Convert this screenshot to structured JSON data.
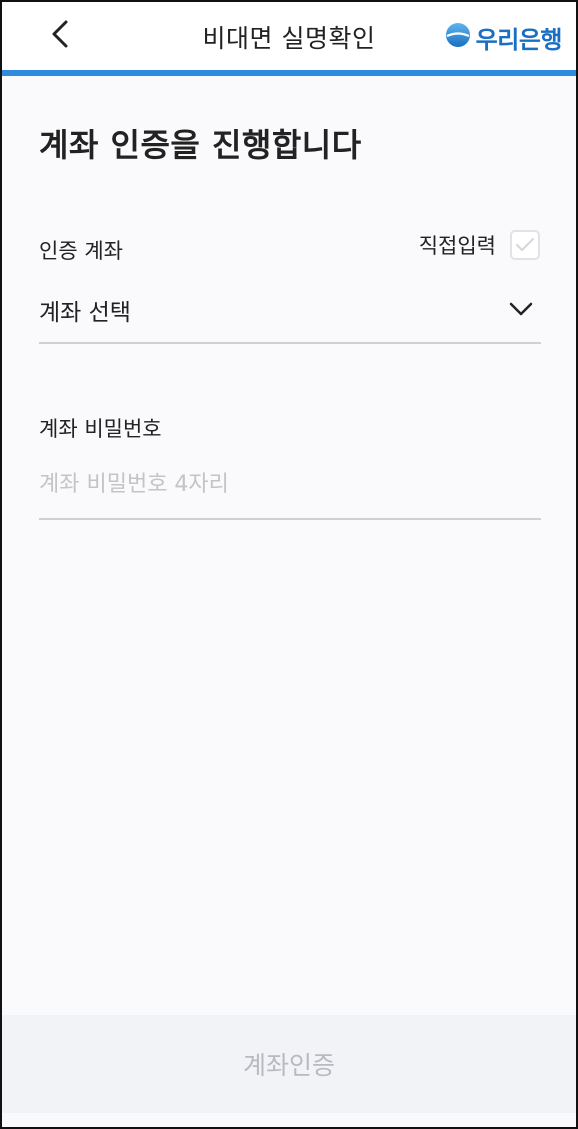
{
  "header": {
    "title": "비대면 실명확인",
    "brand_name": "우리은행",
    "back_icon": "chevron-left-icon",
    "brand_icon": "woori-bank-logo-icon",
    "accent_color": "#2f8be0",
    "brand_color": "#1a6fc2"
  },
  "main": {
    "title": "계좌 인증을 진행합니다",
    "account": {
      "label": "인증 계좌",
      "direct_input_label": "직접입력",
      "direct_input_checked": false,
      "select_value": "계좌 선택",
      "select_icon": "chevron-down-icon"
    },
    "password": {
      "label": "계좌 비밀번호",
      "placeholder": "계좌 비밀번호 4자리",
      "value": ""
    }
  },
  "footer": {
    "submit_label": "계좌인증",
    "submit_enabled": false
  }
}
